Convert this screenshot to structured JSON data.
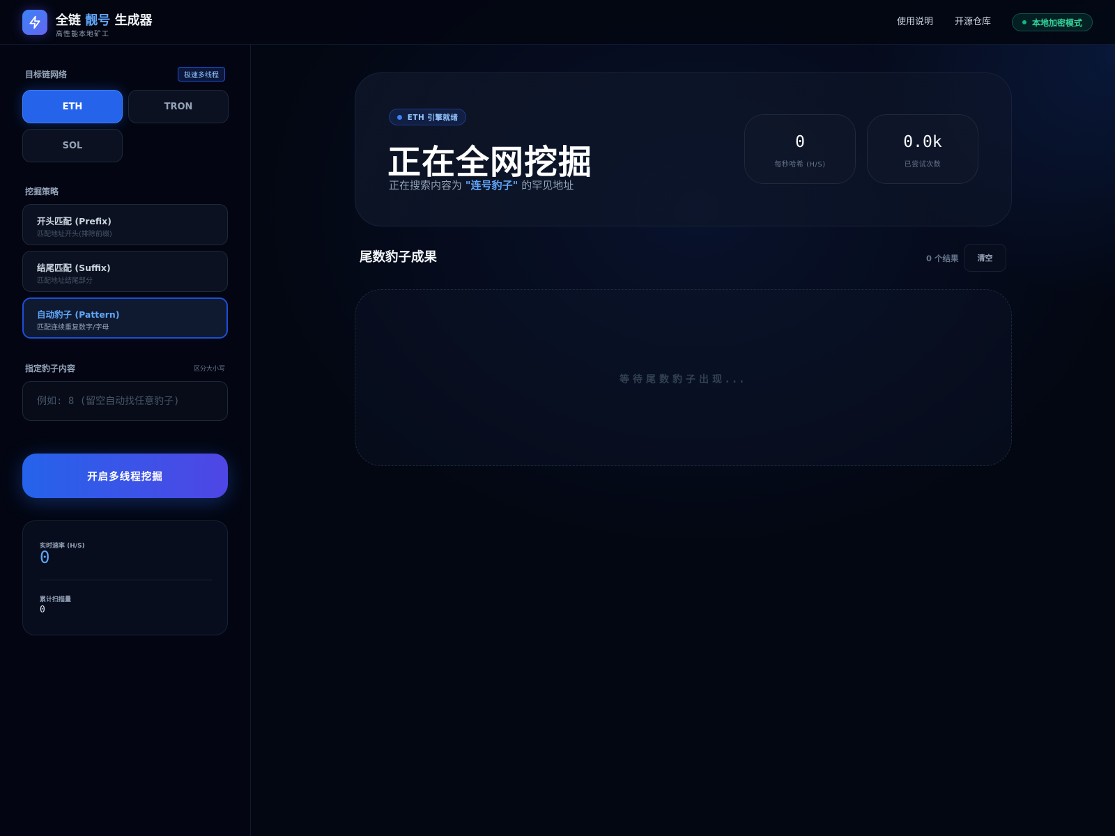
{
  "header": {
    "app_title_part1": "全链",
    "app_title_accent": "靓号",
    "app_title_part2": "生成器",
    "app_subtitle": "高性能本地矿工",
    "nav": [
      "使用说明",
      "开源仓库"
    ],
    "mode_badge": "本地加密模式",
    "logo_icon": "lightning-bolt-icon"
  },
  "sidebar": {
    "chain_label": "目标链网络",
    "chain_tag": "极速多线程",
    "chains": [
      {
        "label": "ETH",
        "active": true
      },
      {
        "label": "TRON",
        "active": false
      },
      {
        "label": "SOL",
        "active": false
      }
    ],
    "strategy_label": "挖掘策略",
    "strategies": [
      {
        "title": "开头匹配 (Prefix)",
        "desc": "匹配地址开头(排除前缀)",
        "active": false
      },
      {
        "title": "结尾匹配 (Suffix)",
        "desc": "匹配地址结尾部分",
        "active": false
      },
      {
        "title": "自动豹子 (Pattern)",
        "desc": "匹配连续重复数字/字母",
        "active": true
      }
    ],
    "content_label": "指定豹子内容",
    "case_hint": "区分大小写",
    "content_input": {
      "value": "",
      "placeholder": "例如: 8 (留空自动找任意豹子)"
    },
    "start_button": "开启多线程挖掘",
    "stats": {
      "rate_label": "实时速率 (H/S)",
      "rate_value": "0",
      "scan_label": "累计扫描量",
      "scan_value": "0"
    }
  },
  "main": {
    "engine_badge": "ETH 引擎就绪",
    "hero_title": "正在全网挖掘",
    "hero_sub_prefix": "正在搜索内容为 ",
    "hero_sub_highlight": "\"连号豹子\"",
    "hero_sub_suffix": " 的罕见地址",
    "metrics": [
      {
        "value": "0",
        "caption": "每秒哈希 (H/S)"
      },
      {
        "value": "0.0k",
        "caption": "已尝试次数"
      }
    ],
    "results_title": "尾数豹子成果",
    "results_count": "0 个结果",
    "clear_button": "清空",
    "empty_text": "等待尾数豹子出现..."
  },
  "colors": {
    "accent": "#2563eb",
    "accent_light": "#60a5fa",
    "success": "#34d399",
    "background": "#030712"
  }
}
